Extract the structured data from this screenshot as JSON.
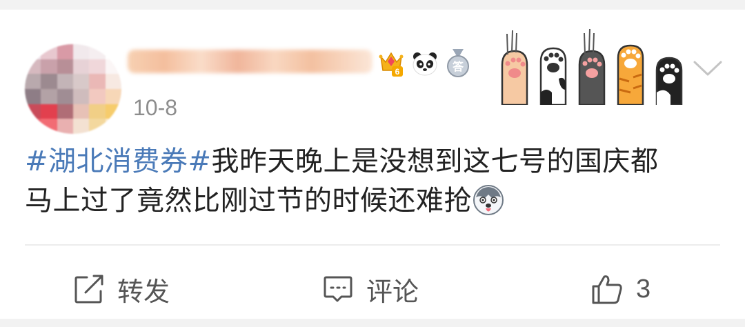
{
  "post": {
    "date": "10-8",
    "content": {
      "topic": "#湖北消费券#",
      "text_line1": "我昨天晚上是没想到这七号的国庆都",
      "text_line2": "马上过了竟然比刚过节的时候还难抢"
    },
    "badges": {
      "crown_level": "6",
      "answer_label": "答"
    },
    "emoji": "husky-emoji"
  },
  "actions": {
    "forward_label": "转发",
    "comment_label": "评论",
    "like_count": "3"
  },
  "colors": {
    "topic": "#4a7ab8",
    "text": "#222222",
    "meta": "#8d8d8d",
    "background": "#f2f2f2"
  }
}
